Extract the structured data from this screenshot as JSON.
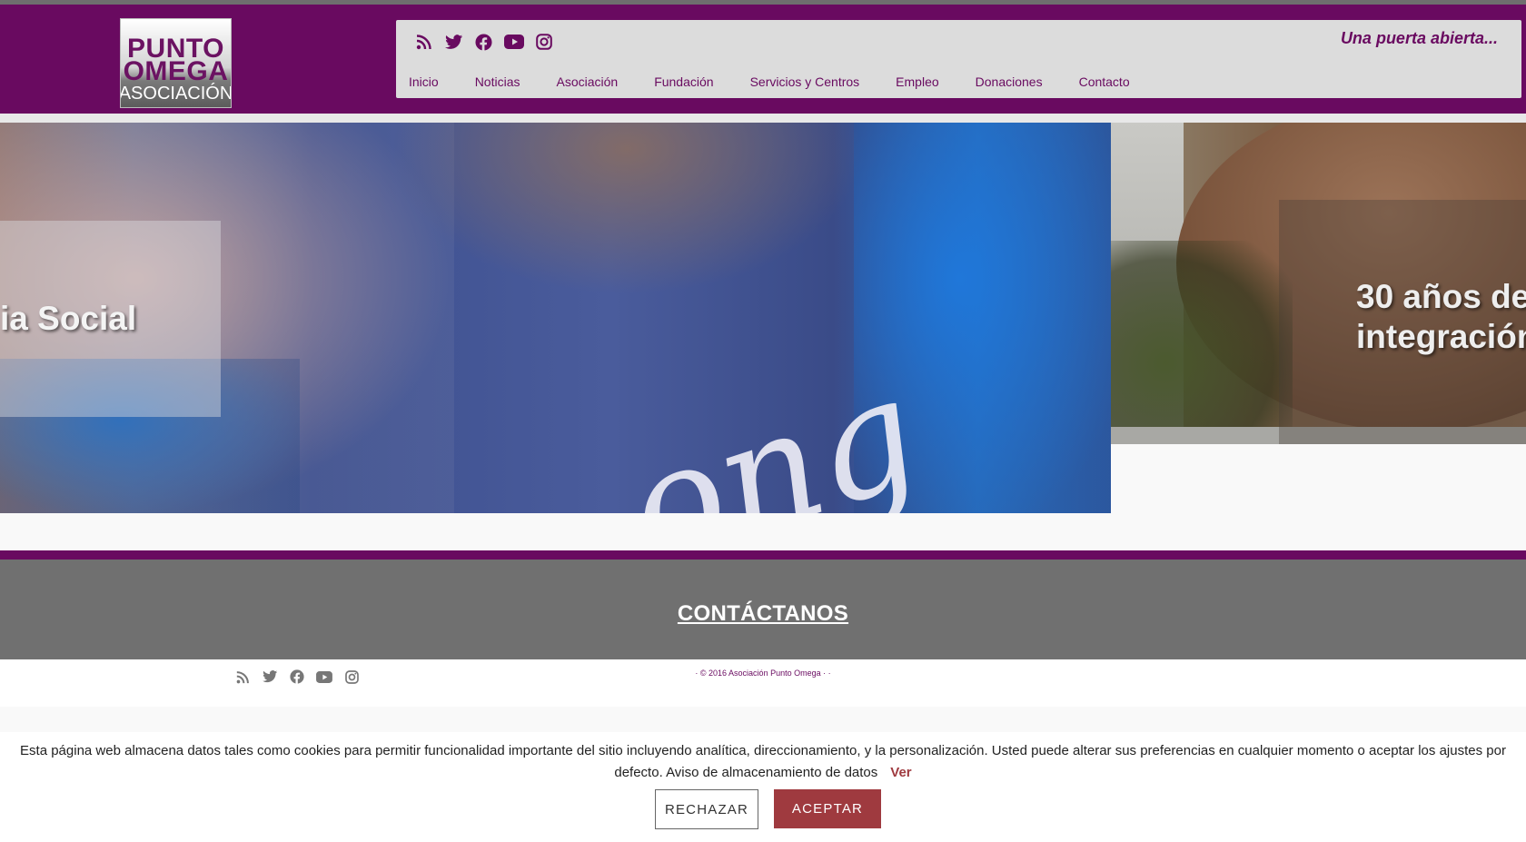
{
  "header": {
    "logo": {
      "line1": "PUNTO",
      "line2": "OMEGA",
      "line3": "ASOCIACIÓN"
    },
    "tagline": "Una puerta abierta...",
    "social_icons": [
      "rss-icon",
      "twitter-icon",
      "facebook-icon",
      "youtube-icon",
      "instagram-icon"
    ],
    "menu": [
      {
        "label": "Inicio"
      },
      {
        "label": "Noticias"
      },
      {
        "label": "Asociación"
      },
      {
        "label": "Fundación"
      },
      {
        "label": "Servicios y Centros"
      },
      {
        "label": "Empleo"
      },
      {
        "label": "Donaciones"
      },
      {
        "label": "Contacto"
      }
    ]
  },
  "slider": {
    "slide1": {
      "caption": "ia Social",
      "shirt_text": "ong"
    },
    "slide2": {
      "caption_line1": "30 años de",
      "caption_line2": "integración"
    }
  },
  "contact": {
    "title": "CONTÁCTANOS"
  },
  "footer": {
    "social_icons": [
      "rss-icon",
      "twitter-icon",
      "facebook-icon",
      "youtube-icon",
      "instagram-icon"
    ],
    "copyright": "· © 2016 Asociación Punto Omega ·   ·"
  },
  "cookie_banner": {
    "text": "Esta página web almacena datos tales como cookies para permitir funcionalidad importante del sitio incluyendo analítica, direccionamiento, y la personalización. Usted puede alterar sus preferencias en cualquier momento o aceptar los ajustes por defecto. Aviso de almacenamiento de datos",
    "link": "Ver",
    "reject_label": "RECHAZAR",
    "accept_label": "ACEPTAR"
  },
  "colors": {
    "brand_purple": "#690a60",
    "nav_background": "#dcdcdc",
    "contact_band": "#707070",
    "accept_button": "#9f3a3f"
  }
}
